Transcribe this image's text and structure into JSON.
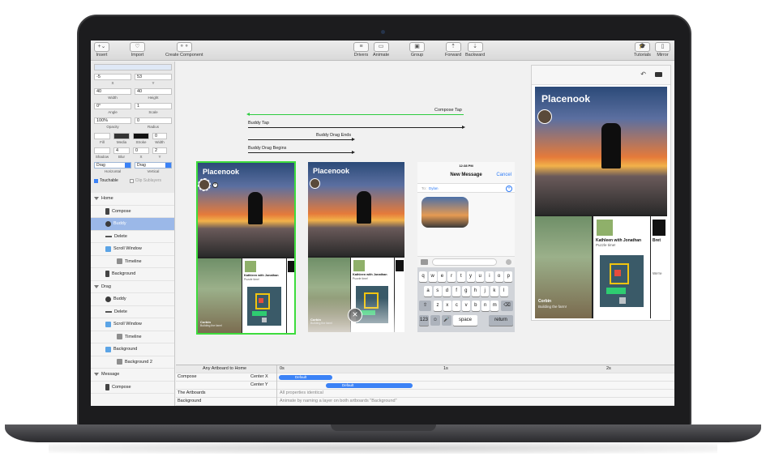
{
  "toolbar": {
    "insert": "Insert",
    "import": "Import",
    "create_component": "Create Component",
    "drivers": "Drivers",
    "animate": "Animate",
    "group": "Group",
    "forward": "Forward",
    "backward": "Backward",
    "tutorials": "Tutorials",
    "mirror": "Mirror"
  },
  "inspector": {
    "x_value": "-5",
    "y_value": "53",
    "x_label": "X",
    "y_label": "Y",
    "width_value": "40",
    "height_value": "40",
    "width_label": "Width",
    "height_label": "Height",
    "angle_value": "0°",
    "scale_value": "1",
    "angle_label": "Angle",
    "scale_label": "Scale",
    "opacity_value": "100%",
    "radius_value": "0",
    "opacity_label": "Opacity",
    "radius_label": "Radius",
    "fill_label": "Fill",
    "media_label": "Media",
    "stroke_label": "Stroke",
    "stroke_width_value": "0",
    "stroke_width_label": "Width",
    "shadow_label": "Shadow",
    "blur_value": "4",
    "blur_label": "Blur",
    "shadow_x_value": "0",
    "shadow_x_label": "X",
    "shadow_y_value": "2",
    "shadow_y_label": "Y",
    "horizontal_value": "Drag",
    "horizontal_label": "Horizontal",
    "vertical_value": "Drag",
    "vertical_label": "Vertical",
    "touchable_label": "Touchable",
    "clip_label": "Clip Sublayers"
  },
  "layers": [
    {
      "label": "Home",
      "type": "group",
      "indent": 0
    },
    {
      "label": "Compose",
      "type": "phone",
      "indent": 1
    },
    {
      "label": "Buddy",
      "type": "avatar",
      "indent": 1,
      "selected": true
    },
    {
      "label": "Delete",
      "type": "dash",
      "indent": 1
    },
    {
      "label": "Scroll Window",
      "type": "folder",
      "indent": 1
    },
    {
      "label": "Timeline",
      "type": "img",
      "indent": 2
    },
    {
      "label": "Background",
      "type": "phone",
      "indent": 1
    },
    {
      "label": "Drag",
      "type": "group",
      "indent": 0
    },
    {
      "label": "Buddy",
      "type": "avatar",
      "indent": 1
    },
    {
      "label": "Delete",
      "type": "dash",
      "indent": 1
    },
    {
      "label": "Scroll Window",
      "type": "folder",
      "indent": 1
    },
    {
      "label": "Timeline",
      "type": "img",
      "indent": 2
    },
    {
      "label": "Background",
      "type": "folder",
      "indent": 1
    },
    {
      "label": "Background 2",
      "type": "img",
      "indent": 2
    },
    {
      "label": "Message",
      "type": "group",
      "indent": 0
    },
    {
      "label": "Compose",
      "type": "phone",
      "indent": 1
    }
  ],
  "transitions": {
    "compose_tap": "Compose Tap",
    "buddy_tap": "Buddy Tap",
    "buddy_drag_ends": "Buddy Drag Ends",
    "buddy_drag_begins": "Buddy Drag Begins"
  },
  "artboards": {
    "brand": "Placenook",
    "card_title": "Kathleen with Jonathan",
    "card_sub": "Puzzle time!",
    "person_name": "Corbin",
    "person_sub": "Building the farm!",
    "card_title_2": "Bret",
    "card_sub_2": "We're"
  },
  "message": {
    "time": "12:38 PM",
    "title": "New Message",
    "cancel": "Cancel",
    "to_label": "To:",
    "to_value": "Dylan",
    "keys_row1": [
      "q",
      "w",
      "e",
      "r",
      "t",
      "y",
      "u",
      "i",
      "o",
      "p"
    ],
    "keys_row2": [
      "a",
      "s",
      "d",
      "f",
      "g",
      "h",
      "j",
      "k",
      "l"
    ],
    "keys_row3": [
      "z",
      "x",
      "c",
      "v",
      "b",
      "n",
      "m"
    ],
    "key_123": "123",
    "key_space": "space",
    "key_return": "return"
  },
  "timeline": {
    "any_artboard": "Any Artboard to Home",
    "t0": "0s",
    "t1": "1s",
    "t2": "2s",
    "compose": "Compose",
    "center_x": "Center X",
    "center_y": "Center Y",
    "the_artboards": "The Artboards",
    "background": "Background",
    "all_identical": "All properties identical",
    "animate_hint": "Animate by naming a layer on both artboards \"Background\"",
    "default_1": "Default",
    "default_2": "Default"
  }
}
